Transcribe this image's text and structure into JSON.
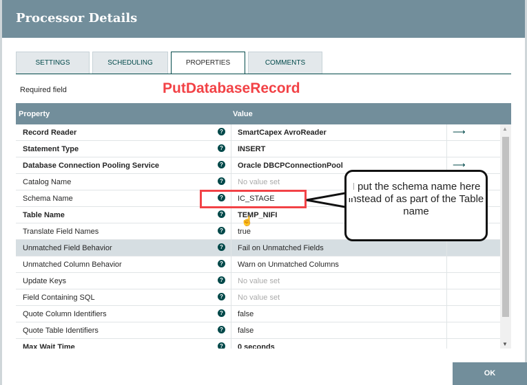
{
  "dialog": {
    "title": "Processor Details"
  },
  "tabs": [
    {
      "label": "SETTINGS"
    },
    {
      "label": "SCHEDULING"
    },
    {
      "label": "PROPERTIES",
      "active": true
    },
    {
      "label": "COMMENTS"
    }
  ],
  "required_label": "Required field",
  "annotation_title": "PutDatabaseRecord",
  "table": {
    "headers": {
      "property": "Property",
      "value": "Value"
    },
    "rows": [
      {
        "property": "Record Reader",
        "required": true,
        "value": "SmartCapex AvroReader",
        "value_bold": true,
        "link": true
      },
      {
        "property": "Statement Type",
        "required": true,
        "value": "INSERT",
        "value_bold": true
      },
      {
        "property": "Database Connection Pooling Service",
        "required": true,
        "value": "Oracle DBCPConnectionPool",
        "value_bold": true,
        "link": true
      },
      {
        "property": "Catalog Name",
        "value": "No value set",
        "empty": true
      },
      {
        "property": "Schema Name",
        "value": "IC_STAGE"
      },
      {
        "property": "Table Name",
        "required": true,
        "value": "TEMP_NIFI",
        "value_bold": true
      },
      {
        "property": "Translate Field Names",
        "value": "true"
      },
      {
        "property": "Unmatched Field Behavior",
        "value": "Fail on Unmatched Fields",
        "selected": true
      },
      {
        "property": "Unmatched Column Behavior",
        "value": "Warn on Unmatched Columns"
      },
      {
        "property": "Update Keys",
        "value": "No value set",
        "empty": true
      },
      {
        "property": "Field Containing SQL",
        "value": "No value set",
        "empty": true
      },
      {
        "property": "Quote Column Identifiers",
        "value": "false"
      },
      {
        "property": "Quote Table Identifiers",
        "value": "false"
      },
      {
        "property": "Max Wait Time",
        "required": true,
        "value": "0 seconds",
        "value_bold": true
      }
    ]
  },
  "callout": {
    "text": "I put the schema name here instead of as part of the Table name"
  },
  "ok_label": "OK",
  "icons": {
    "help": "question-circle-icon",
    "link": "arrow-right-icon"
  },
  "colors": {
    "header": "#728e9b",
    "accent": "#004849",
    "annotation": "#f24246"
  }
}
